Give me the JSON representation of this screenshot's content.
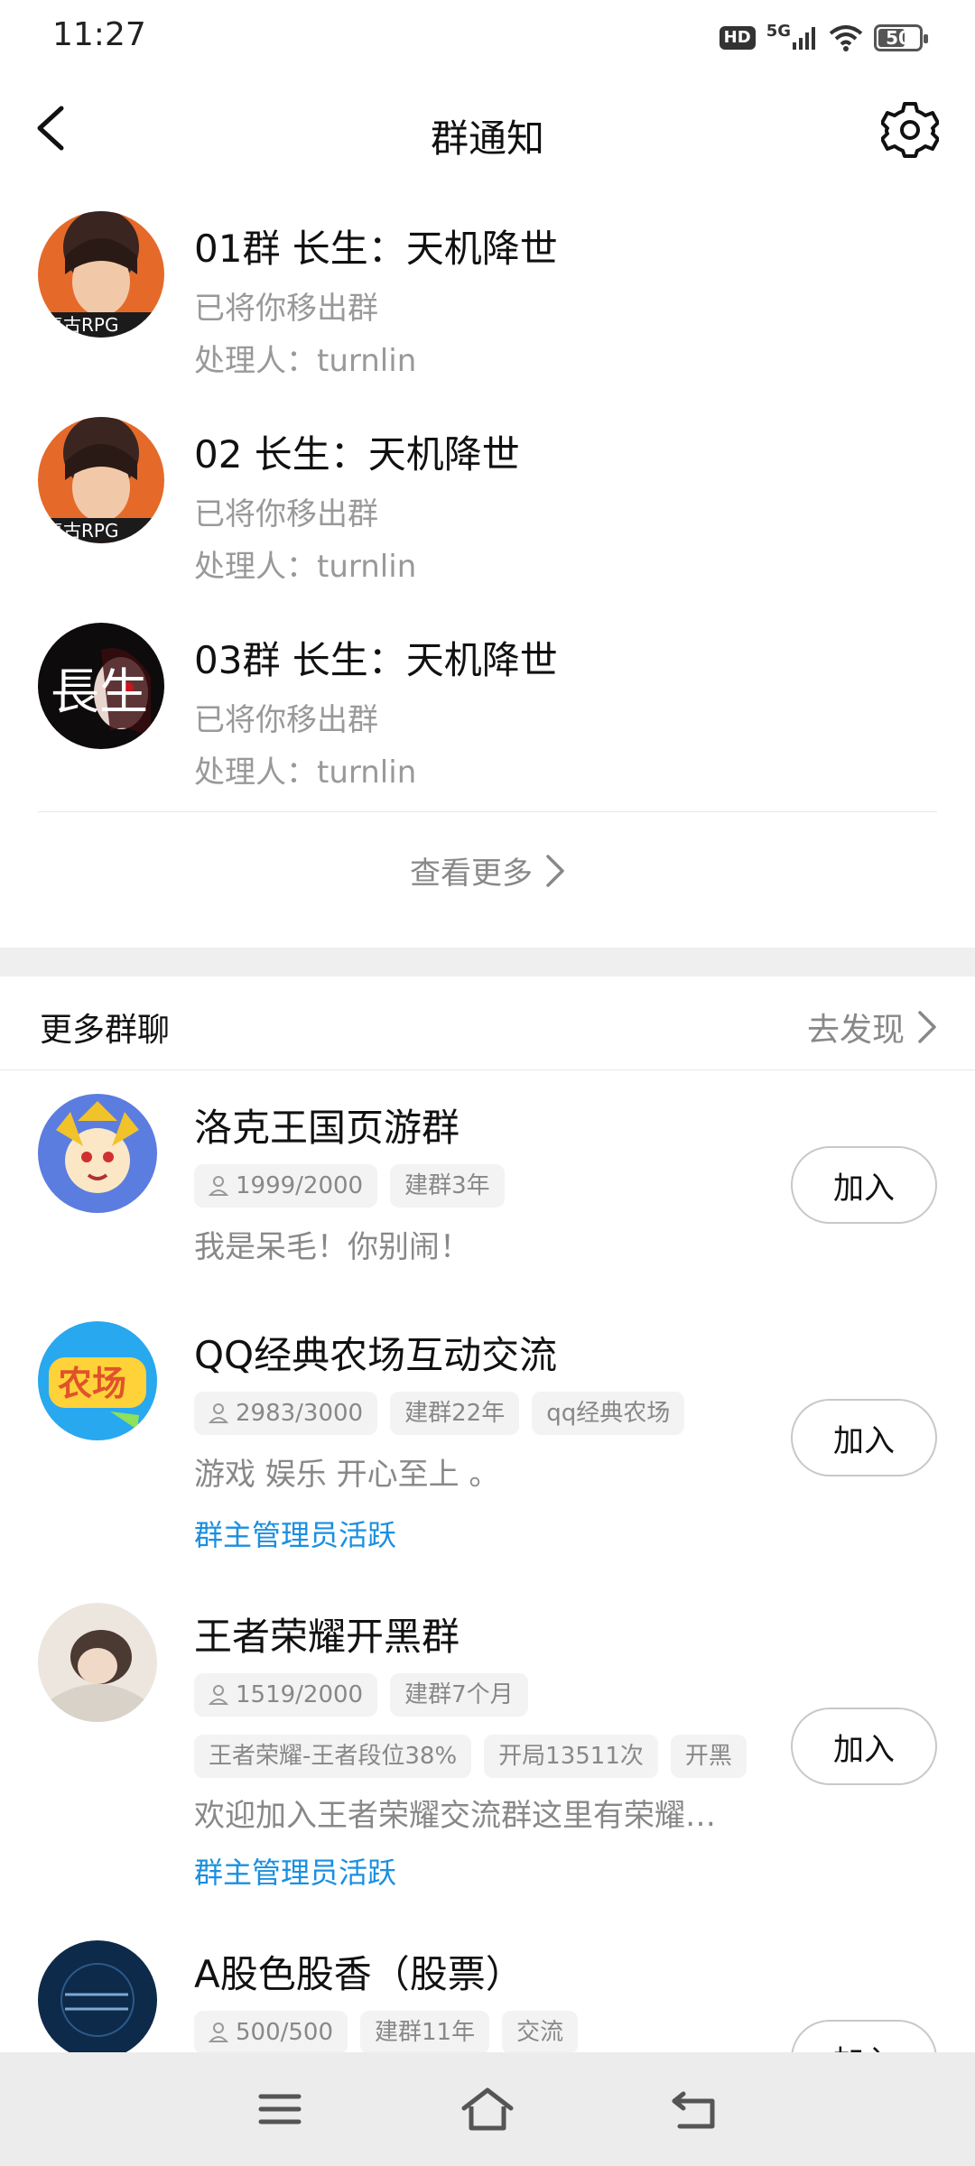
{
  "status_bar": {
    "time": "11:27",
    "network": "5G",
    "battery": "50"
  },
  "header": {
    "title": "群通知"
  },
  "notices": [
    {
      "title": "01群 长生：天机降世",
      "action": "已将你移出群",
      "handler": "处理人：turnlin",
      "avatar_label": "复古RPG"
    },
    {
      "title": "02 长生：天机降世",
      "action": "已将你移出群",
      "handler": "处理人：turnlin",
      "avatar_label": "复古RPG"
    },
    {
      "title": "03群 长生：天机降世",
      "action": "已将你移出群",
      "handler": "处理人：turnlin",
      "avatar_label": "長生"
    }
  ],
  "see_more": "查看更多",
  "more_groups": {
    "title": "更多群聊",
    "discover": "去发现",
    "join_label": "加入",
    "groups": [
      {
        "name": "洛克王国页游群",
        "members": "1999/2000",
        "tags": [
          "建群3年"
        ],
        "extra_tags": [],
        "desc": "我是呆毛！你别闹！",
        "active": ""
      },
      {
        "name": "QQ经典农场互动交流",
        "members": "2983/3000",
        "tags": [
          "建群22年",
          "qq经典农场"
        ],
        "extra_tags": [],
        "desc": "游戏 娱乐 开心至上 。",
        "active": "群主管理员活跃",
        "avatar_label": "农场"
      },
      {
        "name": "王者荣耀开黑群",
        "members": "1519/2000",
        "tags": [
          "建群7个月"
        ],
        "extra_tags": [
          "王者荣耀-王者段位38%",
          "开局13511次",
          "开黑"
        ],
        "desc": "欢迎加入王者荣耀交流群这里有荣耀…",
        "active": "群主管理员活跃"
      },
      {
        "name": "A股色股香（股票）",
        "members": "500/500",
        "tags": [
          "建群11年",
          "交流"
        ],
        "extra_tags": [],
        "desc": "",
        "active": ""
      }
    ]
  },
  "colors": {
    "accent_blue": "#1a8fe0",
    "tag_bg": "#f3f3f3",
    "muted_text": "#999999"
  }
}
